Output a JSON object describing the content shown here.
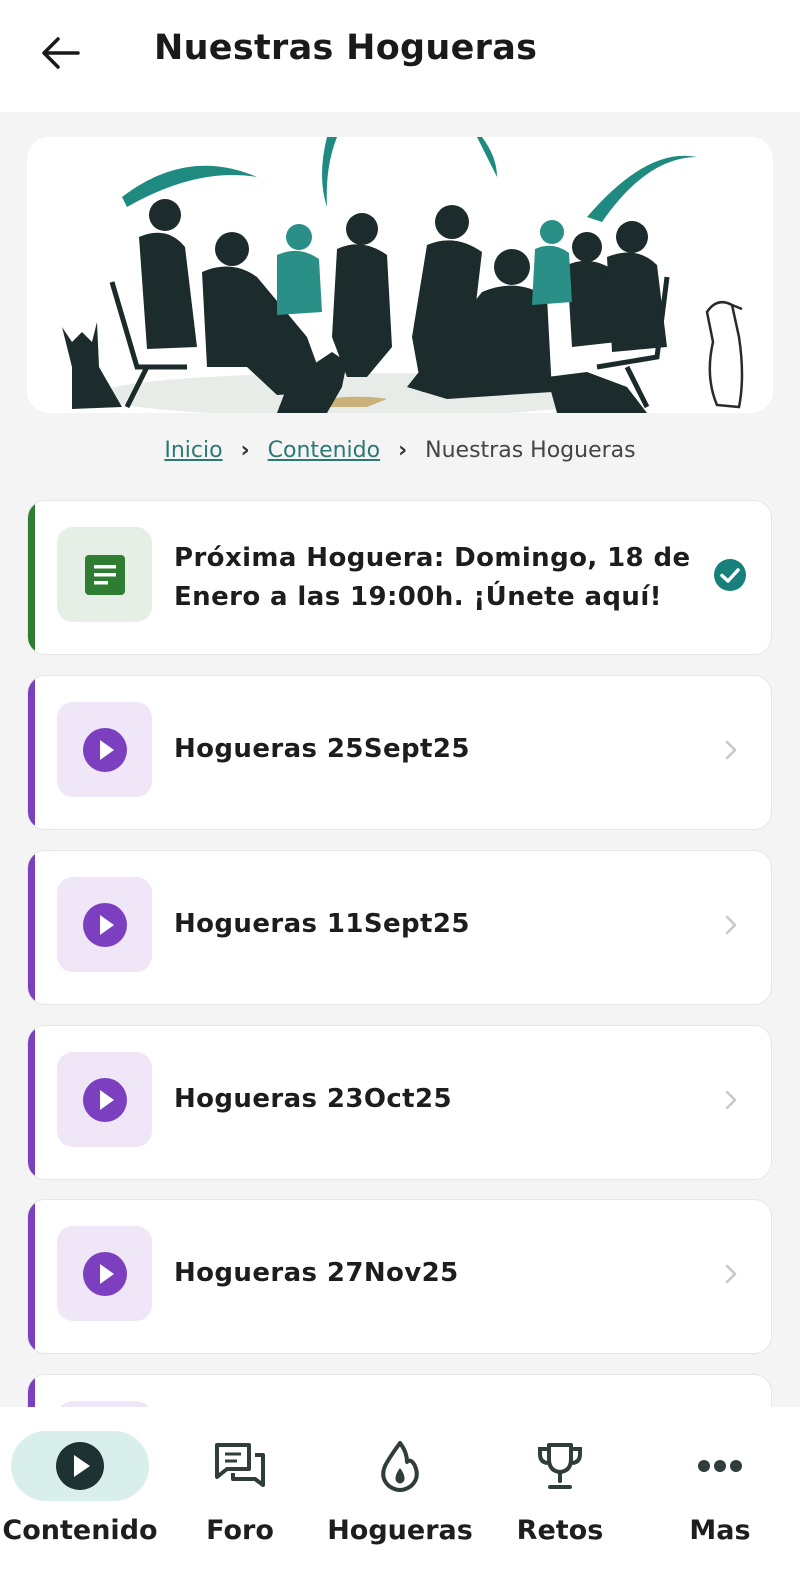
{
  "header": {
    "title": "Nuestras Hogueras"
  },
  "breadcrumb": {
    "items": [
      "Inicio",
      "Contenido",
      "Nuestras Hogueras"
    ]
  },
  "lessons": [
    {
      "title_line1": "Próxima Hoguera: Domingo, 18 de",
      "title_line2": "Enero a las 19:00h. ¡Únete aquí!",
      "type": "document-icon",
      "status": "completed",
      "accent": "#2e7d32"
    },
    {
      "title": "Hogueras 25Sept25",
      "type": "play-icon",
      "accent": "#7b3fbf"
    },
    {
      "title": "Hogueras 11Sept25",
      "type": "play-icon",
      "accent": "#7b3fbf"
    },
    {
      "title": "Hogueras 23Oct25",
      "type": "play-icon",
      "accent": "#7b3fbf"
    },
    {
      "title": "Hogueras 27Nov25",
      "type": "play-icon",
      "accent": "#7b3fbf"
    }
  ],
  "nav": {
    "items": [
      {
        "label": "Contenido",
        "icon": "play-circle-icon",
        "active": true
      },
      {
        "label": "Foro",
        "icon": "chat-icon"
      },
      {
        "label": "Hogueras",
        "icon": "flame-icon"
      },
      {
        "label": "Retos",
        "icon": "trophy-icon"
      },
      {
        "label": "Mas",
        "icon": "more-icon"
      }
    ]
  },
  "colors": {
    "teal": "#2a7a73",
    "purple": "#7b3fbf",
    "green": "#2e7d32",
    "check": "#17807a"
  }
}
